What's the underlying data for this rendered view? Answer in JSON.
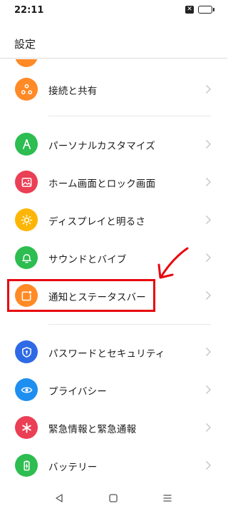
{
  "status_bar": {
    "time": "22:11"
  },
  "header": {
    "title": "設定"
  },
  "items": [
    {
      "label": "接続と共有",
      "color": "#ff8a26",
      "icon": "share-icon"
    },
    {
      "label": "パーソナルカスタマイズ",
      "color": "#2dbd50",
      "icon": "brush-icon"
    },
    {
      "label": "ホーム画面とロック画面",
      "color": "#ea3f55",
      "icon": "picture-icon"
    },
    {
      "label": "ディスプレイと明るさ",
      "color": "#fdb606",
      "icon": "sun-icon"
    },
    {
      "label": "サウンドとバイブ",
      "color": "#2dbd50",
      "icon": "bell-icon"
    },
    {
      "label": "通知とステータスバー",
      "color": "#ff8a26",
      "icon": "notification-icon"
    },
    {
      "label": "パスワードとセキュリティ",
      "color": "#2f6ae6",
      "icon": "shield-icon"
    },
    {
      "label": "プライバシー",
      "color": "#1e8ff0",
      "icon": "privacy-eye-icon"
    },
    {
      "label": "緊急情報と緊急通報",
      "color": "#ea3f55",
      "icon": "asterisk-icon"
    },
    {
      "label": "バッテリー",
      "color": "#2dbd50",
      "icon": "battery-icon"
    }
  ],
  "annotation": {
    "highlight_color": "#e8060e"
  }
}
